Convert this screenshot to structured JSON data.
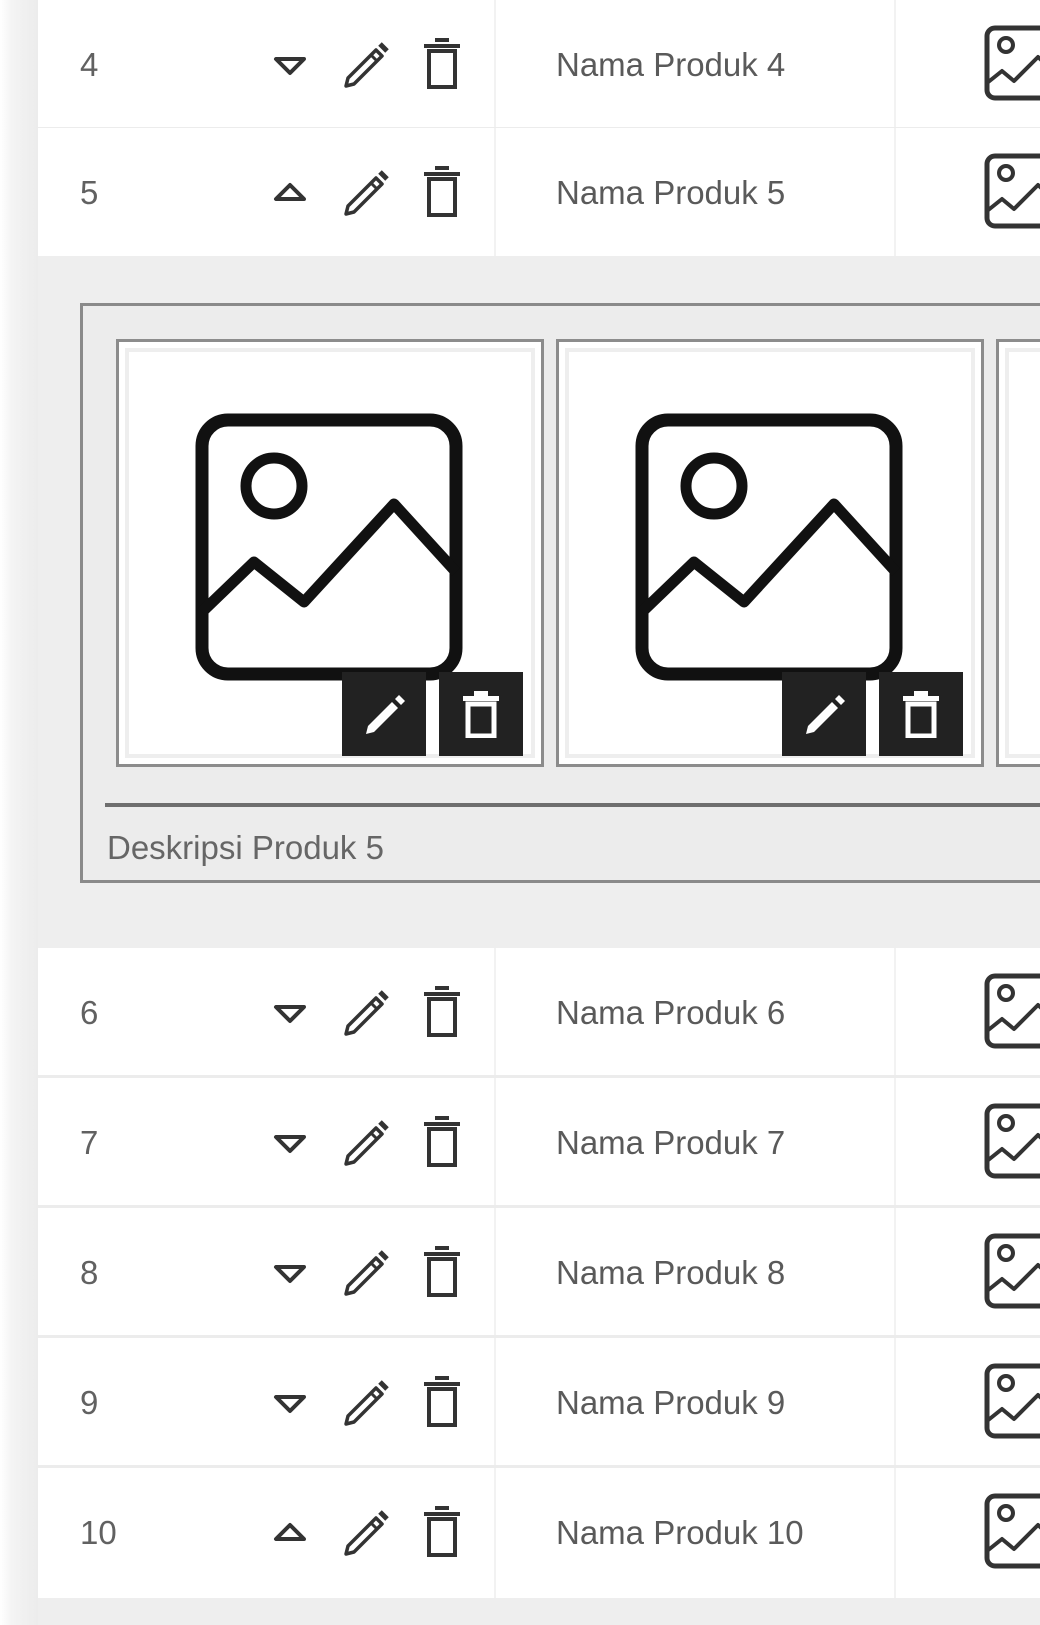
{
  "rows": [
    {
      "number": "4",
      "name": "Nama Produk 4",
      "expanded": false
    },
    {
      "number": "5",
      "name": "Nama Produk 5",
      "expanded": true
    },
    {
      "number": "6",
      "name": "Nama Produk 6",
      "expanded": false
    },
    {
      "number": "7",
      "name": "Nama Produk 7",
      "expanded": false
    },
    {
      "number": "8",
      "name": "Nama Produk 8",
      "expanded": false
    },
    {
      "number": "9",
      "name": "Nama Produk 9",
      "expanded": false
    },
    {
      "number": "10",
      "name": "Nama Produk 10",
      "expanded": true
    }
  ],
  "detail": {
    "description": "Deskripsi Produk 5",
    "images": [
      "image-placeholder-icon",
      "image-placeholder-icon",
      "image-placeholder-icon"
    ]
  },
  "icons": {
    "expand": "triangle-down-icon",
    "collapse": "triangle-up-icon",
    "edit": "pencil-icon",
    "delete": "trash-icon",
    "thumbnail": "image-placeholder-icon"
  },
  "colors": {
    "detail_background": "#eeeeee",
    "image_action_button": "#222222",
    "text": "#5a5a5a"
  }
}
